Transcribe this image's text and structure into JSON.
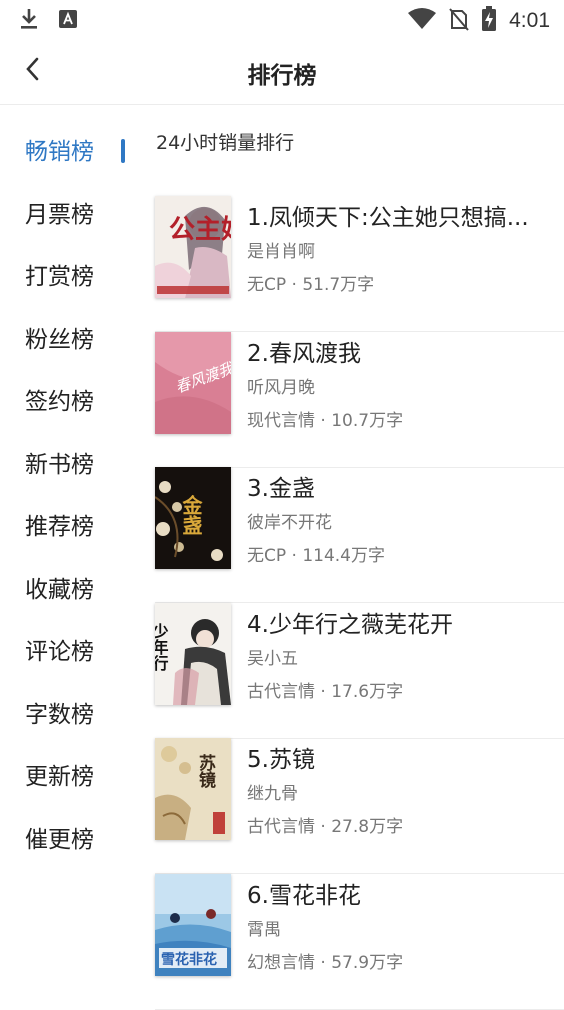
{
  "status_bar": {
    "time": "4:01",
    "icons": [
      "download-icon",
      "a-icon",
      "wifi-icon",
      "no-sim-icon",
      "battery-charging-icon"
    ]
  },
  "header": {
    "title": "排行榜",
    "back_icon": "chevron-left-icon"
  },
  "sidebar": {
    "items": [
      {
        "label": "畅销榜",
        "active": true
      },
      {
        "label": "月票榜"
      },
      {
        "label": "打赏榜"
      },
      {
        "label": "粉丝榜"
      },
      {
        "label": "签约榜"
      },
      {
        "label": "新书榜"
      },
      {
        "label": "推荐榜"
      },
      {
        "label": "收藏榜"
      },
      {
        "label": "评论榜"
      },
      {
        "label": "字数榜"
      },
      {
        "label": "更新榜"
      },
      {
        "label": "催更榜"
      }
    ],
    "accent_color": "#2f78c4"
  },
  "main": {
    "section_title": "24小时销量排行",
    "books": [
      {
        "title": "1.凤倾天下:公主她只想搞...",
        "author": "是肖肖啊",
        "meta": "无CP · 51.7万字",
        "cover_text": "公主她"
      },
      {
        "title": "2.春风渡我",
        "author": "听风月晚",
        "meta": "现代言情 · 10.7万字",
        "cover_text": "春风渡我"
      },
      {
        "title": "3.金盏",
        "author": "彼岸不开花",
        "meta": "无CP · 114.4万字",
        "cover_text": "金盏"
      },
      {
        "title": "4.少年行之薇芜花开",
        "author": "吴小五",
        "meta": "古代言情 · 17.6万字",
        "cover_text": "少年行"
      },
      {
        "title": "5.苏镜",
        "author": "继九骨",
        "meta": "古代言情 · 27.8万字",
        "cover_text": "苏镜"
      },
      {
        "title": "6.雪花非花",
        "author": "霄禺",
        "meta": "幻想言情 · 57.9万字",
        "cover_text": "雪花非花"
      }
    ]
  }
}
